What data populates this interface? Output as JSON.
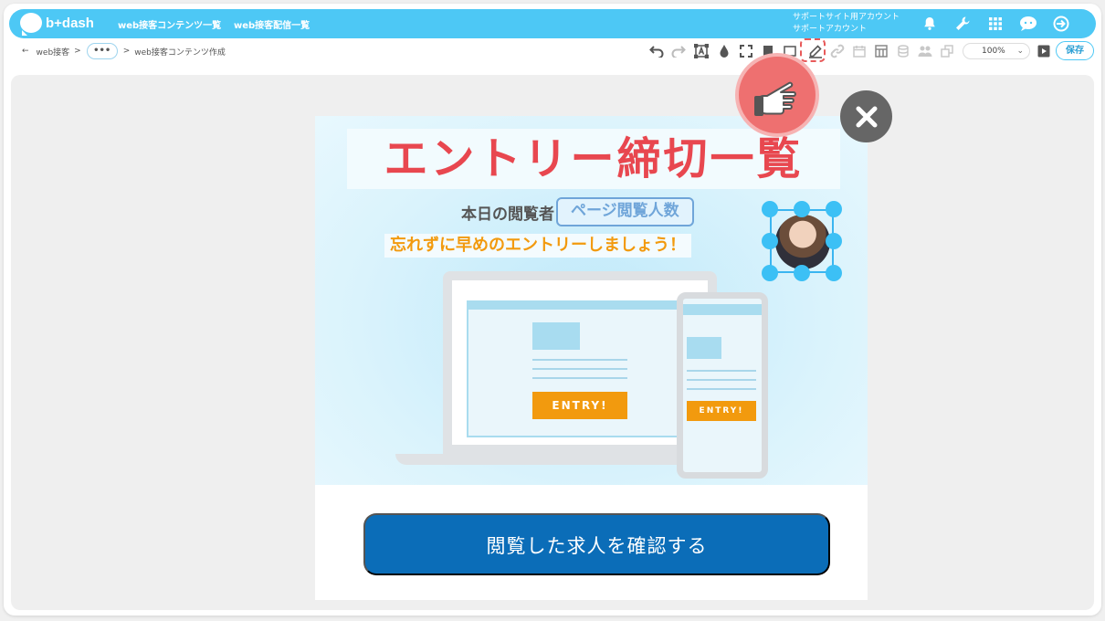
{
  "header": {
    "logo_text": "b+dash",
    "nav": [
      "web接客コンテンツ一覧",
      "web接客配信一覧"
    ],
    "account_line1": "サポートサイト用アカウント",
    "account_line2": "サポートアカウント"
  },
  "breadcrumb": {
    "back_arrow": "←",
    "root": "web接客",
    "separator": ">",
    "ellipsis": "•••",
    "current": "web接客コンテンツ作成"
  },
  "toolbar": {
    "zoom": "100%",
    "zoom_caret": "⌄",
    "save_label": "保存"
  },
  "banner": {
    "title": "エントリー締切一覧",
    "viewers_label": "本日の閲覧者",
    "viewers_variable": "ページ閲覧人数",
    "subline": "忘れずに早めのエントリーしましょう！",
    "entry_label": "ENTRY!",
    "cta_label": "閲覧した求人を確認する"
  },
  "colors": {
    "header_bg": "#4dc8f5",
    "title_red": "#e8474f",
    "accent_orange": "#f29a0e",
    "cta_blue": "#0b6db8",
    "selection_blue": "#3cc0f5"
  }
}
